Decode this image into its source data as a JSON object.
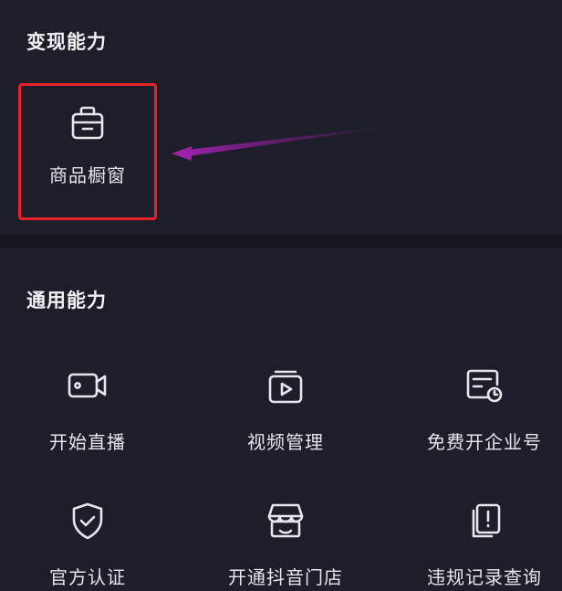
{
  "monetize": {
    "title": "变现能力",
    "tools": [
      {
        "label": "商品橱窗",
        "icon": "shopping-bag-icon"
      }
    ]
  },
  "general": {
    "title": "通用能力",
    "tools": [
      {
        "label": "开始直播",
        "icon": "camera-icon"
      },
      {
        "label": "视频管理",
        "icon": "video-folder-icon"
      },
      {
        "label": "免费开企业号",
        "icon": "document-clock-icon"
      },
      {
        "label": "官方认证",
        "icon": "shield-check-icon"
      },
      {
        "label": "开通抖音门店",
        "icon": "storefront-icon"
      },
      {
        "label": "违规记录查询",
        "icon": "record-alert-icon"
      }
    ]
  },
  "colors": {
    "background": "#15161f",
    "panel": "#1d1e29",
    "highlight_border": "#e8212a",
    "arrow": "#8b1f9a"
  }
}
